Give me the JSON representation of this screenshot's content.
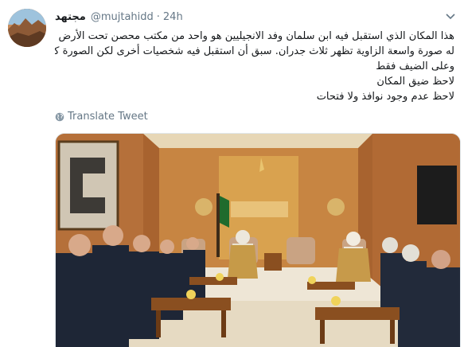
{
  "tweet": {
    "author_name": "مجتهد",
    "handle": "@mujtahidd",
    "separator": "·",
    "time": "24h",
    "lines": [
      "هذا المكان الذي استقبل فيه ابن سلمان وفد الانجيليين هو واحد من مكتب محصن تحت الأرض وهي أول مرة تؤخذ",
      "له صورة واسعة الزاوية تظهر ثلاث جدران. سبق أن استقبل فيه شخصيات أخرى لكن الصورة كانت موجهة عليه",
      "وعلى الضيف فقط",
      "لاحظ ضيق المكان",
      "لاحظ عدم وجود نوافذ ولا فتحات"
    ],
    "translate_label": "Translate Tweet"
  },
  "icons": {
    "caret": "chevron-down-icon",
    "translate": "globe-icon"
  },
  "colors": {
    "text": "#14171a",
    "secondary": "#657786",
    "wood": "#b5703a",
    "carpet": "#eee6d6"
  }
}
